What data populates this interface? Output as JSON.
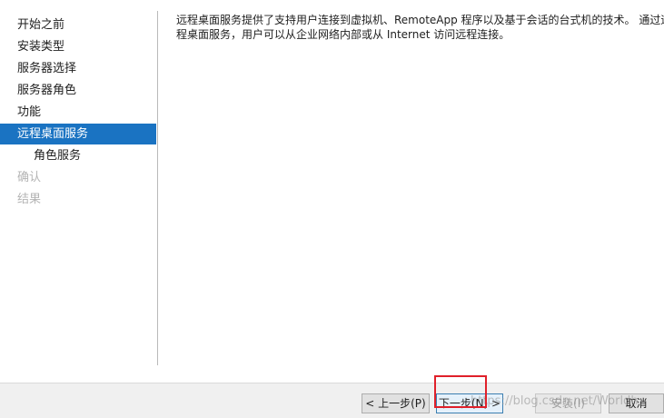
{
  "sidebar": {
    "items": [
      {
        "label": "开始之前",
        "state": "normal"
      },
      {
        "label": "安装类型",
        "state": "normal"
      },
      {
        "label": "服务器选择",
        "state": "normal"
      },
      {
        "label": "服务器角色",
        "state": "normal"
      },
      {
        "label": "功能",
        "state": "normal"
      },
      {
        "label": "远程桌面服务",
        "state": "active"
      },
      {
        "label": "角色服务",
        "state": "normal"
      },
      {
        "label": "确认",
        "state": "disabled"
      },
      {
        "label": "结果",
        "state": "disabled"
      }
    ]
  },
  "content": {
    "line1": "远程桌面服务提供了支持用户连接到虚拟机、RemoteApp 程序以及基于会话的台式机的技术。 通过远",
    "line2": "程桌面服务，用户可以从企业网络内部或从 Internet 访问远程连接。"
  },
  "footer": {
    "prev_label": "< 上一步(P)",
    "next_label": "下一步(N) >",
    "install_label": "安装(I)",
    "cancel_label": "取消"
  },
  "watermark": "https://blog.csdn.net/Worldh",
  "colors": {
    "accent": "#1a73c2",
    "annotation": "#e0202a"
  }
}
